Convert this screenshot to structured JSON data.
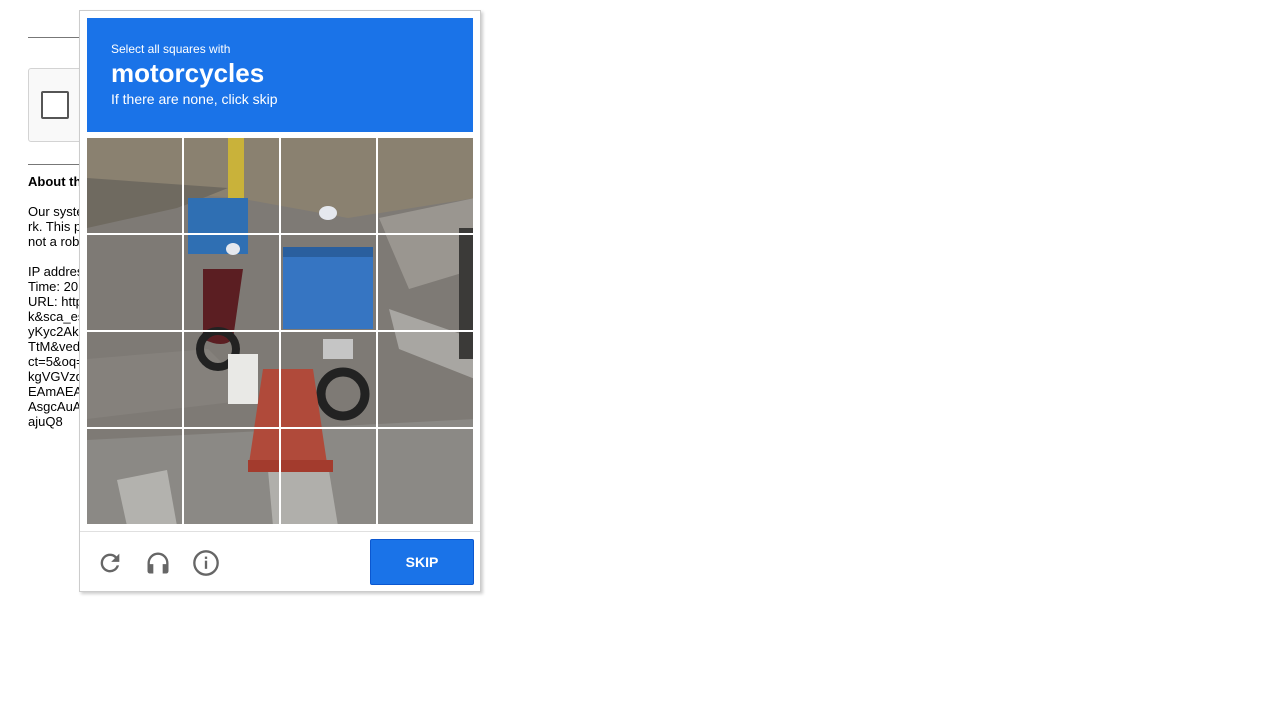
{
  "background_page": {
    "about_heading": "About th",
    "paragraph_lines": [
      "Our syste",
      "rk. This p",
      "not a rob"
    ],
    "info_lines": [
      "IP addres",
      "Time: 20",
      "URL: http",
      "k&sca_es",
      "yKyc2Ak",
      "TtM&ved",
      "ct=5&oq=",
      "kgVGVzd",
      "EAmAEA",
      "AsgcAuA",
      "ajuQ8"
    ]
  },
  "challenge": {
    "instruction_small": "Select all squares with",
    "target_object": "motorcycles",
    "instruction_sub": "If there are none, click skip",
    "header_color": "#1a73e8",
    "grid_size": 4,
    "tiles": [
      {
        "label": "tile-1"
      },
      {
        "label": "tile-2"
      },
      {
        "label": "tile-3"
      },
      {
        "label": "tile-4"
      },
      {
        "label": "tile-5"
      },
      {
        "label": "tile-6"
      },
      {
        "label": "tile-7"
      },
      {
        "label": "tile-8"
      },
      {
        "label": "tile-9"
      },
      {
        "label": "tile-10"
      },
      {
        "label": "tile-11"
      },
      {
        "label": "tile-12"
      },
      {
        "label": "tile-13"
      },
      {
        "label": "tile-14"
      },
      {
        "label": "tile-15"
      },
      {
        "label": "tile-16"
      }
    ],
    "footer": {
      "icons": [
        "reload-icon",
        "audio-icon",
        "info-icon"
      ],
      "skip_label": "SKIP"
    }
  }
}
